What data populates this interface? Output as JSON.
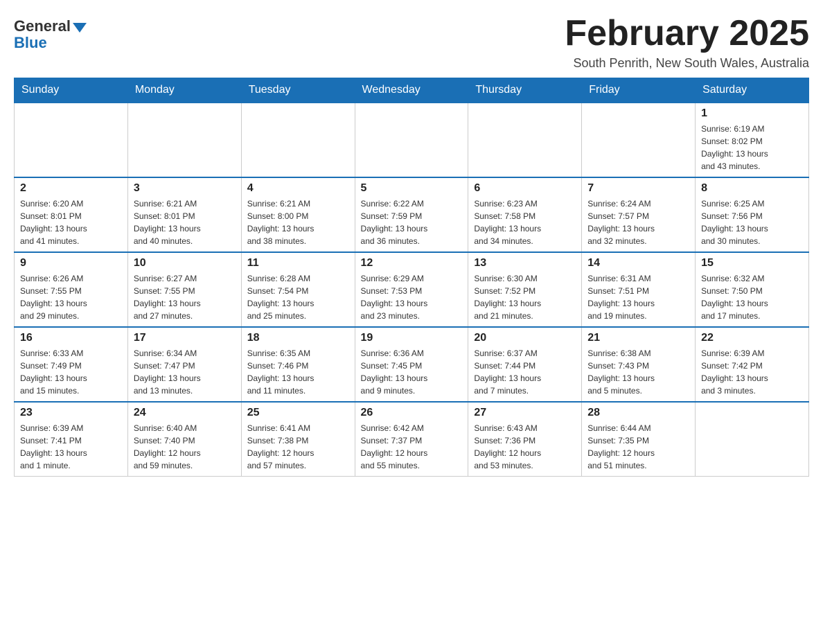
{
  "logo": {
    "general": "General",
    "blue": "Blue"
  },
  "title": "February 2025",
  "location": "South Penrith, New South Wales, Australia",
  "days_of_week": [
    "Sunday",
    "Monday",
    "Tuesday",
    "Wednesday",
    "Thursday",
    "Friday",
    "Saturday"
  ],
  "weeks": [
    [
      {
        "day": "",
        "info": ""
      },
      {
        "day": "",
        "info": ""
      },
      {
        "day": "",
        "info": ""
      },
      {
        "day": "",
        "info": ""
      },
      {
        "day": "",
        "info": ""
      },
      {
        "day": "",
        "info": ""
      },
      {
        "day": "1",
        "info": "Sunrise: 6:19 AM\nSunset: 8:02 PM\nDaylight: 13 hours\nand 43 minutes."
      }
    ],
    [
      {
        "day": "2",
        "info": "Sunrise: 6:20 AM\nSunset: 8:01 PM\nDaylight: 13 hours\nand 41 minutes."
      },
      {
        "day": "3",
        "info": "Sunrise: 6:21 AM\nSunset: 8:01 PM\nDaylight: 13 hours\nand 40 minutes."
      },
      {
        "day": "4",
        "info": "Sunrise: 6:21 AM\nSunset: 8:00 PM\nDaylight: 13 hours\nand 38 minutes."
      },
      {
        "day": "5",
        "info": "Sunrise: 6:22 AM\nSunset: 7:59 PM\nDaylight: 13 hours\nand 36 minutes."
      },
      {
        "day": "6",
        "info": "Sunrise: 6:23 AM\nSunset: 7:58 PM\nDaylight: 13 hours\nand 34 minutes."
      },
      {
        "day": "7",
        "info": "Sunrise: 6:24 AM\nSunset: 7:57 PM\nDaylight: 13 hours\nand 32 minutes."
      },
      {
        "day": "8",
        "info": "Sunrise: 6:25 AM\nSunset: 7:56 PM\nDaylight: 13 hours\nand 30 minutes."
      }
    ],
    [
      {
        "day": "9",
        "info": "Sunrise: 6:26 AM\nSunset: 7:55 PM\nDaylight: 13 hours\nand 29 minutes."
      },
      {
        "day": "10",
        "info": "Sunrise: 6:27 AM\nSunset: 7:55 PM\nDaylight: 13 hours\nand 27 minutes."
      },
      {
        "day": "11",
        "info": "Sunrise: 6:28 AM\nSunset: 7:54 PM\nDaylight: 13 hours\nand 25 minutes."
      },
      {
        "day": "12",
        "info": "Sunrise: 6:29 AM\nSunset: 7:53 PM\nDaylight: 13 hours\nand 23 minutes."
      },
      {
        "day": "13",
        "info": "Sunrise: 6:30 AM\nSunset: 7:52 PM\nDaylight: 13 hours\nand 21 minutes."
      },
      {
        "day": "14",
        "info": "Sunrise: 6:31 AM\nSunset: 7:51 PM\nDaylight: 13 hours\nand 19 minutes."
      },
      {
        "day": "15",
        "info": "Sunrise: 6:32 AM\nSunset: 7:50 PM\nDaylight: 13 hours\nand 17 minutes."
      }
    ],
    [
      {
        "day": "16",
        "info": "Sunrise: 6:33 AM\nSunset: 7:49 PM\nDaylight: 13 hours\nand 15 minutes."
      },
      {
        "day": "17",
        "info": "Sunrise: 6:34 AM\nSunset: 7:47 PM\nDaylight: 13 hours\nand 13 minutes."
      },
      {
        "day": "18",
        "info": "Sunrise: 6:35 AM\nSunset: 7:46 PM\nDaylight: 13 hours\nand 11 minutes."
      },
      {
        "day": "19",
        "info": "Sunrise: 6:36 AM\nSunset: 7:45 PM\nDaylight: 13 hours\nand 9 minutes."
      },
      {
        "day": "20",
        "info": "Sunrise: 6:37 AM\nSunset: 7:44 PM\nDaylight: 13 hours\nand 7 minutes."
      },
      {
        "day": "21",
        "info": "Sunrise: 6:38 AM\nSunset: 7:43 PM\nDaylight: 13 hours\nand 5 minutes."
      },
      {
        "day": "22",
        "info": "Sunrise: 6:39 AM\nSunset: 7:42 PM\nDaylight: 13 hours\nand 3 minutes."
      }
    ],
    [
      {
        "day": "23",
        "info": "Sunrise: 6:39 AM\nSunset: 7:41 PM\nDaylight: 13 hours\nand 1 minute."
      },
      {
        "day": "24",
        "info": "Sunrise: 6:40 AM\nSunset: 7:40 PM\nDaylight: 12 hours\nand 59 minutes."
      },
      {
        "day": "25",
        "info": "Sunrise: 6:41 AM\nSunset: 7:38 PM\nDaylight: 12 hours\nand 57 minutes."
      },
      {
        "day": "26",
        "info": "Sunrise: 6:42 AM\nSunset: 7:37 PM\nDaylight: 12 hours\nand 55 minutes."
      },
      {
        "day": "27",
        "info": "Sunrise: 6:43 AM\nSunset: 7:36 PM\nDaylight: 12 hours\nand 53 minutes."
      },
      {
        "day": "28",
        "info": "Sunrise: 6:44 AM\nSunset: 7:35 PM\nDaylight: 12 hours\nand 51 minutes."
      },
      {
        "day": "",
        "info": ""
      }
    ]
  ]
}
